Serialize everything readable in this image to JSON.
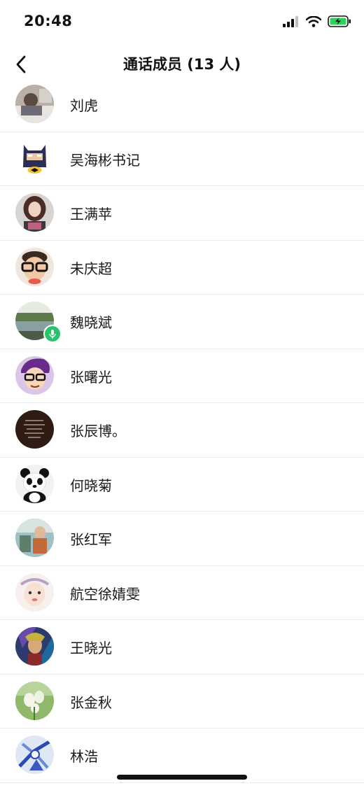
{
  "status_bar": {
    "time": "20:48",
    "battery_color": "#30d158"
  },
  "nav": {
    "title": "通话成员 (13 人)"
  },
  "members": [
    {
      "name": "刘虎"
    },
    {
      "name": "吴海彬书记"
    },
    {
      "name": "王满苹"
    },
    {
      "name": "未庆超"
    },
    {
      "name": "魏晓斌",
      "speaking": true
    },
    {
      "name": "张曙光"
    },
    {
      "name": "张辰博。"
    },
    {
      "name": "何晓菊"
    },
    {
      "name": "张红军"
    },
    {
      "name": "航空徐婧雯"
    },
    {
      "name": "王晓光"
    },
    {
      "name": "张金秋"
    },
    {
      "name": "林浩"
    }
  ],
  "accent_colors": {
    "speaking_badge": "#27c26a"
  }
}
